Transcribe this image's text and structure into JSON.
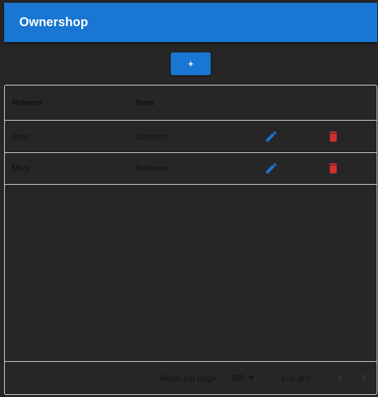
{
  "app": {
    "title": "Ownershop"
  },
  "toolbar": {
    "add_label": "+"
  },
  "table": {
    "columns": [
      "Prénom",
      "Nom"
    ],
    "rows": [
      {
        "first_name": "John",
        "last_name": "Johnson"
      },
      {
        "first_name": "Mary",
        "last_name": "Robinson"
      }
    ],
    "row_actions": [
      "edit-icon",
      "delete-icon"
    ]
  },
  "pagination": {
    "rows_per_page_label": "Rows per page:",
    "rows_per_page_value": "100",
    "range_text": "1–2 of 2",
    "prev_icon": "chevron-left-icon",
    "next_icon": "chevron-right-icon"
  },
  "colors": {
    "primary": "#1976d2",
    "background": "#262626",
    "edit_icon": "#1976d2",
    "delete_icon": "#d32f2f",
    "border": "#e0e0e0"
  }
}
